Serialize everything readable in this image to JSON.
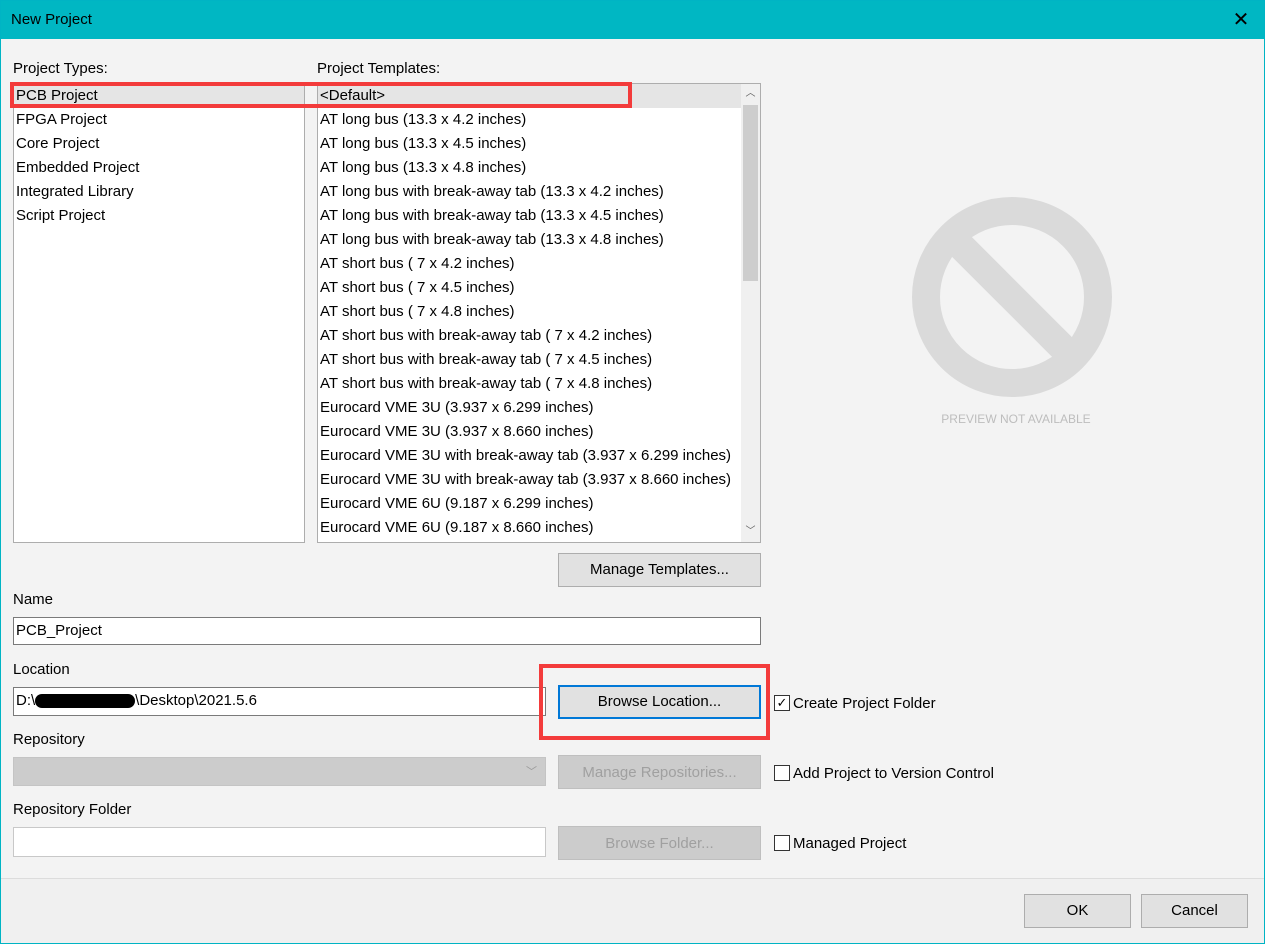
{
  "window": {
    "title": "New Project",
    "close_icon": "close-icon"
  },
  "project_types": {
    "label": "Project Types:",
    "items": [
      "PCB Project",
      "FPGA Project",
      "Core Project",
      "Embedded Project",
      "Integrated Library",
      "Script Project"
    ],
    "selected": "PCB Project"
  },
  "project_templates": {
    "label": "Project Templates:",
    "items": [
      "<Default>",
      "AT long bus (13.3 x 4.2 inches)",
      "AT long bus (13.3 x 4.5 inches)",
      "AT long bus (13.3 x 4.8 inches)",
      "AT long bus with break-away tab (13.3 x 4.2 inches)",
      "AT long bus with break-away tab (13.3 x 4.5 inches)",
      "AT long bus with break-away tab (13.3 x 4.8 inches)",
      "AT short bus ( 7 x 4.2 inches)",
      "AT short bus ( 7 x 4.5 inches)",
      "AT short bus ( 7 x 4.8 inches)",
      "AT short bus with break-away tab ( 7 x 4.2 inches)",
      "AT short bus with break-away tab ( 7 x 4.5 inches)",
      "AT short bus with break-away tab ( 7 x 4.8 inches)",
      "Eurocard VME 3U (3.937 x 6.299 inches)",
      "Eurocard VME 3U (3.937 x 8.660 inches)",
      "Eurocard VME 3U with break-away tab (3.937 x 6.299 inches)",
      "Eurocard VME 3U with break-away tab (3.937 x 8.660 inches)",
      "Eurocard VME 6U (9.187 x 6.299 inches)",
      "Eurocard VME 6U (9.187 x 8.660 inches)"
    ],
    "selected": "<Default>"
  },
  "manage_templates": "Manage Templates...",
  "preview": {
    "text": "PREVIEW NOT AVAILABLE",
    "icon": "no-preview-icon"
  },
  "name": {
    "label": "Name",
    "value": "PCB_Project"
  },
  "location": {
    "label": "Location",
    "value_prefix": "D:\\",
    "value_suffix": "\\Desktop\\2021.5.6",
    "browse": "Browse Location...",
    "create_folder": "Create Project Folder",
    "create_folder_checked": true
  },
  "repository": {
    "label": "Repository",
    "value": "",
    "manage": "Manage Repositories...",
    "add_vc": "Add Project to Version Control",
    "add_vc_checked": false
  },
  "repo_folder": {
    "label": "Repository Folder",
    "value": "",
    "browse": "Browse Folder...",
    "managed": "Managed Project",
    "managed_checked": false
  },
  "footer": {
    "ok": "OK",
    "cancel": "Cancel"
  },
  "colors": {
    "titlebar": "#00b7c3",
    "highlight": "#f33b3b"
  }
}
